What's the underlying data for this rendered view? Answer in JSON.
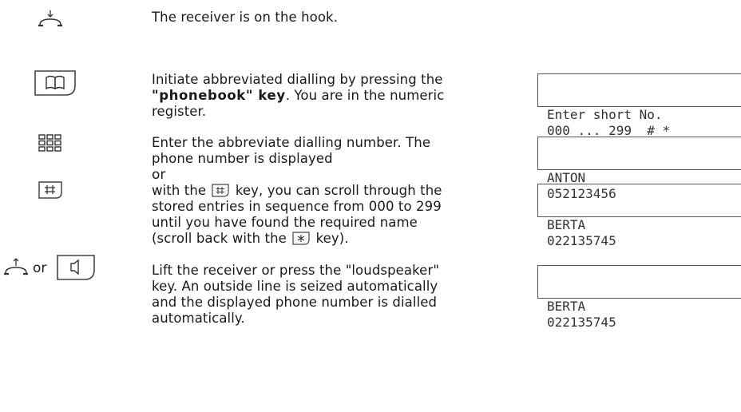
{
  "steps": [
    {
      "text": "The receiver is on the hook."
    },
    {
      "text_pre": "Initiate abbreviated dialling by pressing the ",
      "text_bold": "\"phonebook\" key",
      "text_post": ". You are in the numeric register.",
      "display": [
        "Enter short No.",
        "000 ... 299  # *"
      ]
    },
    {
      "text": "Enter the abbreviate dialling number. The phone number is displayed",
      "display": [
        "ANTON",
        "052123456"
      ]
    },
    {
      "or_label": "or",
      "text_pre": "with the ",
      "text_mid": " key, you can scroll through the stored entries in sequence from 000 to 299 until you have found the required name (scroll back with the ",
      "text_post": " key).",
      "display": [
        "BERTA",
        "022135745"
      ]
    },
    {
      "or_label": "or",
      "text": "Lift the receiver or press the \"loudspeaker\" key. An outside line is seized automatically and the displayed phone number is dialled automatically.",
      "display": [
        "BERTA",
        "022135745"
      ]
    }
  ],
  "icons": {
    "hook_down": "receiver-on-hook-icon",
    "phonebook": "phonebook-key-icon",
    "keypad": "keypad-icon",
    "hash": "hash-key-icon",
    "star": "star-key-icon",
    "hook_up": "receiver-lift-icon",
    "speaker": "loudspeaker-key-icon"
  }
}
